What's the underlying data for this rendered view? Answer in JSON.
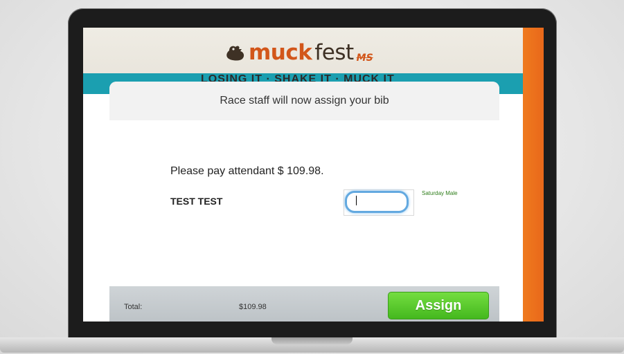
{
  "logo": {
    "part1": "muck",
    "part2": "fest",
    "suffix": "MS"
  },
  "slogan": "LOSING IT · SHAKE IT · MUCK IT",
  "dialog": {
    "header": "Race staff will now assign your bib",
    "pay_message": "Please pay attendant $ 109.98.",
    "participant_name": "TEST TEST",
    "bib_input_value": "",
    "category": "Saturday Male",
    "footer": {
      "total_label": "Total:",
      "total_value": "$109.98",
      "assign_label": "Assign"
    }
  },
  "colors": {
    "accent_orange": "#e9681a",
    "teal": "#1b9fb0",
    "assign_green": "#5ccc30",
    "category_green": "#2e7d1a"
  }
}
